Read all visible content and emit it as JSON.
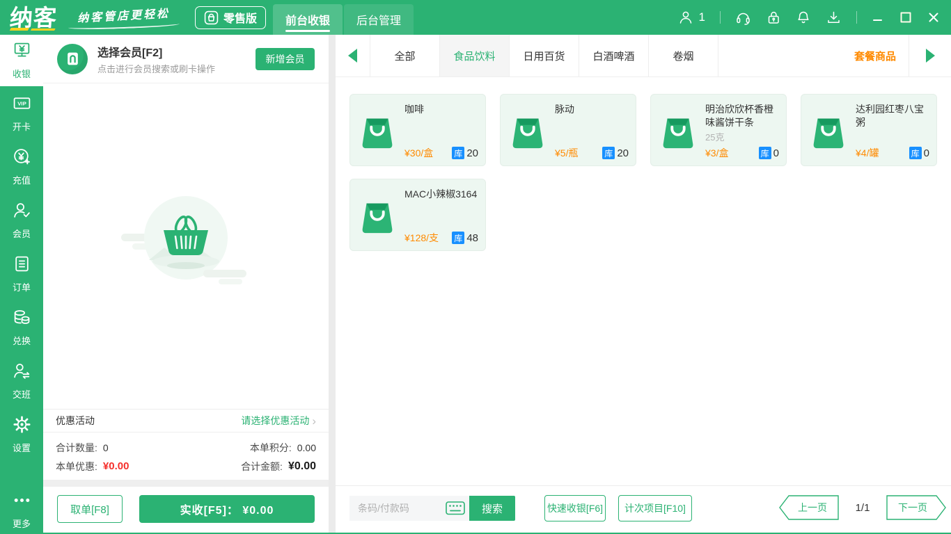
{
  "app": {
    "logo_text": "纳客",
    "slogan": "纳客管店更轻松",
    "edition": "零售版",
    "nav_tabs": [
      {
        "label": "前台收银",
        "active": true
      },
      {
        "label": "后台管理",
        "active": false
      }
    ],
    "user_count": "1"
  },
  "sidebar": {
    "items": [
      {
        "label": "收银",
        "icon": "cash-register",
        "active": true
      },
      {
        "label": "开卡",
        "icon": "vip-card",
        "active": false
      },
      {
        "label": "充值",
        "icon": "recharge",
        "active": false
      },
      {
        "label": "会员",
        "icon": "member",
        "active": false
      },
      {
        "label": "订单",
        "icon": "order",
        "active": false
      },
      {
        "label": "兑换",
        "icon": "exchange",
        "active": false
      },
      {
        "label": "交班",
        "icon": "shift",
        "active": false
      },
      {
        "label": "设置",
        "icon": "settings",
        "active": false
      }
    ],
    "more_label": "更多"
  },
  "member_panel": {
    "title": "选择会员[F2]",
    "subtitle": "点击进行会员搜索或刷卡操作",
    "add_button": "新增会员"
  },
  "promo_row": {
    "label": "优惠活动",
    "action": "请选择优惠活动"
  },
  "totals": {
    "qty_label": "合计数量:",
    "qty_value": "0",
    "points_label": "本单积分:",
    "points_value": "0.00",
    "discount_label": "本单优惠:",
    "discount_value": "¥0.00",
    "amount_label": "合计金额:",
    "amount_value": "¥0.00"
  },
  "actions": {
    "hold_order": "取单[F8]",
    "checkout": "实收[F5]：  ¥0.00"
  },
  "categories": {
    "tabs": [
      {
        "label": "全部",
        "active": false
      },
      {
        "label": "食品饮料",
        "active": true
      },
      {
        "label": "日用百货",
        "active": false
      },
      {
        "label": "白酒啤酒",
        "active": false
      },
      {
        "label": "卷烟",
        "active": false
      }
    ],
    "special_tab": "套餐商品"
  },
  "products": {
    "stock_badge": "库",
    "items": [
      {
        "name": "咖啡",
        "spec": "",
        "price": "¥30/盒",
        "stock": "20"
      },
      {
        "name": "脉动",
        "spec": "",
        "price": "¥5/瓶",
        "stock": "20"
      },
      {
        "name": "明治欣欣杯香橙味酱饼干条",
        "spec": "25克",
        "price": "¥3/盒",
        "stock": "0"
      },
      {
        "name": "达利园红枣八宝粥",
        "spec": "",
        "price": "¥4/罐",
        "stock": "0"
      },
      {
        "name": "MAC小辣椒3164",
        "spec": "",
        "price": "¥128/支",
        "stock": "48"
      }
    ]
  },
  "bottom_bar": {
    "search_placeholder": "条码/付款码",
    "search_button": "搜索",
    "quick_checkout": "快速收银[F6]",
    "count_item": "计次项目[F10]",
    "pagination": {
      "prev": "上一页",
      "current": "1/1",
      "next": "下一页"
    }
  },
  "colors": {
    "primary": "#2bb273",
    "price_orange": "#ff8a00",
    "stock_blue": "#1890ff",
    "discount_red": "#f5302c"
  }
}
